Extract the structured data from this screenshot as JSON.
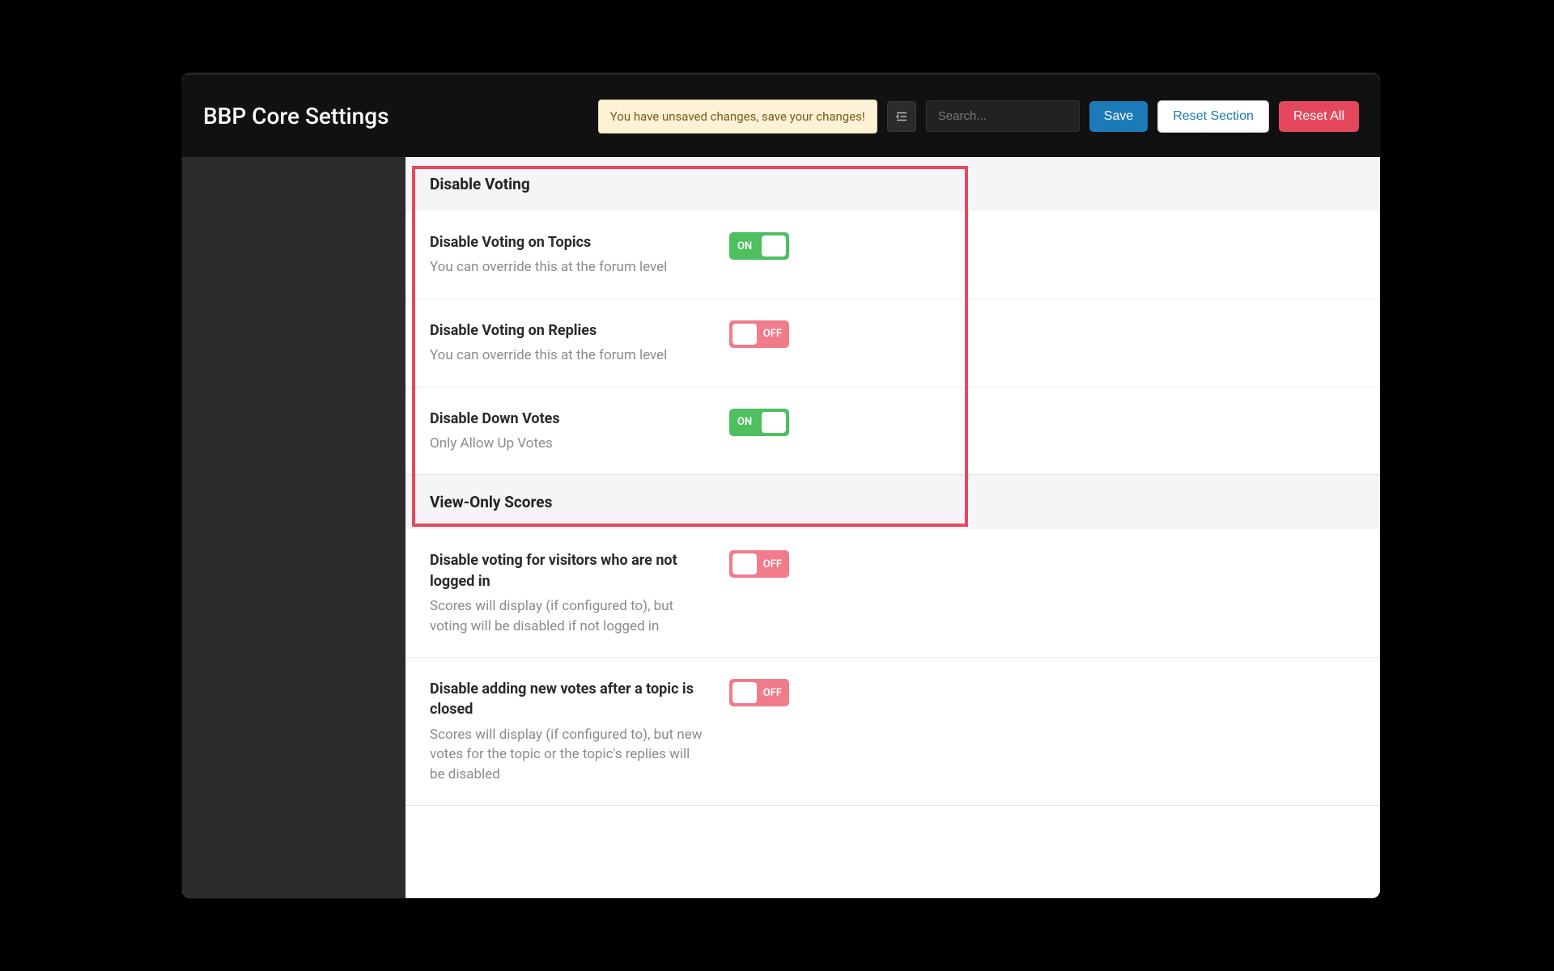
{
  "header": {
    "title": "BBP Core Settings",
    "unsaved_notice": "You have unsaved changes, save your changes!",
    "search_placeholder": "Search...",
    "save_label": "Save",
    "reset_section_label": "Reset Section",
    "reset_all_label": "Reset All"
  },
  "toggle_labels": {
    "on": "ON",
    "off": "OFF"
  },
  "sections": {
    "disable_voting": {
      "heading": "Disable Voting",
      "items": [
        {
          "title": "Disable Voting on Topics",
          "desc": "You can override this at the forum level",
          "state": "on"
        },
        {
          "title": "Disable Voting on Replies",
          "desc": "You can override this at the forum level",
          "state": "off"
        },
        {
          "title": "Disable Down Votes",
          "desc": "Only Allow Up Votes",
          "state": "on"
        }
      ]
    },
    "view_only": {
      "heading": "View-Only Scores",
      "items": [
        {
          "title": "Disable voting for visitors who are not logged in",
          "desc": "Scores will display (if configured to), but voting will be disabled if not logged in",
          "state": "off"
        },
        {
          "title": "Disable adding new votes after a topic is closed",
          "desc": "Scores will display (if configured to), but new votes for the topic or the topic's replies will be disabled",
          "state": "off"
        }
      ]
    }
  }
}
